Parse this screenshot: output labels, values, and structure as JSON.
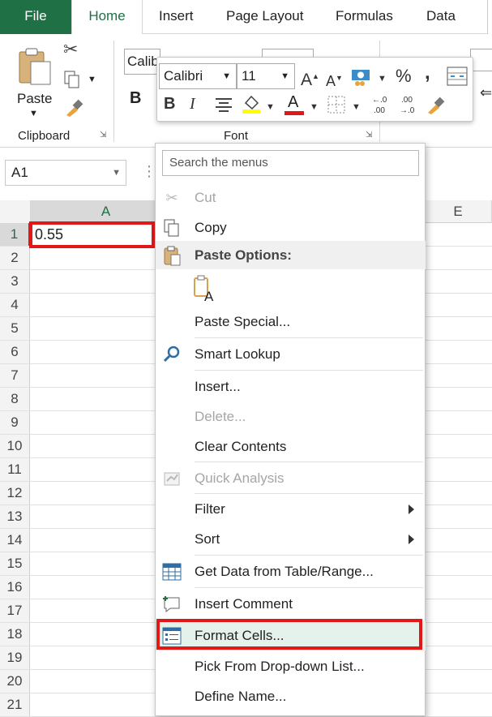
{
  "ribbon": {
    "tabs": [
      "File",
      "Home",
      "Insert",
      "Page Layout",
      "Formulas",
      "Data"
    ],
    "clipboard_group": "Clipboard",
    "paste_label": "Paste",
    "font_group": "Font",
    "font_box_partial": "Calib",
    "bold_glyph": "B"
  },
  "formula_bar": {
    "name_box": "A1"
  },
  "grid": {
    "columns": [
      "A",
      "E"
    ],
    "rows": [
      "1",
      "2",
      "3",
      "4",
      "5",
      "6",
      "7",
      "8",
      "9",
      "10",
      "11",
      "12",
      "13",
      "14",
      "15",
      "16",
      "17",
      "18",
      "19",
      "20",
      "21"
    ],
    "cell_a1": "0.55"
  },
  "mini_toolbar": {
    "font_name": "Calibri",
    "font_size": "11",
    "percent": "%",
    "comma": ",",
    "bold": "B",
    "italic": "I",
    "font_color_glyph": "A",
    "font_color": "#e21818",
    "fill_color": "#ffff00"
  },
  "context_menu": {
    "search_placeholder": "Search the menus",
    "items": {
      "cut": "Cut",
      "copy": "Copy",
      "paste_options": "Paste Options:",
      "paste_special": "Paste Special...",
      "smart_lookup": "Smart Lookup",
      "insert": "Insert...",
      "delete": "Delete...",
      "clear_contents": "Clear Contents",
      "quick_analysis": "Quick Analysis",
      "filter": "Filter",
      "sort": "Sort",
      "get_data": "Get Data from Table/Range...",
      "insert_comment": "Insert Comment",
      "format_cells": "Format Cells...",
      "pick_list": "Pick From Drop-down List...",
      "define_name": "Define Name..."
    }
  },
  "colors": {
    "excel_green": "#1f7045",
    "highlight_red": "#e21818"
  }
}
